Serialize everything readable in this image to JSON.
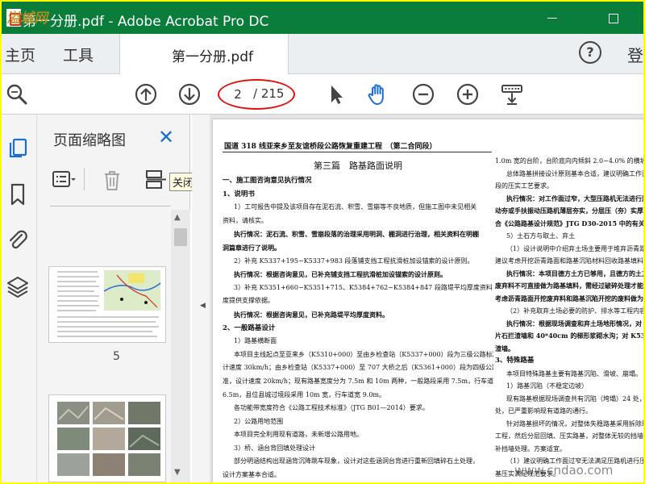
{
  "window": {
    "title": "第一分册.pdf - Adobe Acrobat Pro DC",
    "brand_color": "#0a7d3a",
    "accent_color": "#1b6fd3",
    "highlight_color": "#e01010"
  },
  "tabs": {
    "home": "主页",
    "tools": "工具",
    "document": "第一分册.pdf",
    "help": "?",
    "signin": "登"
  },
  "toolbar": {
    "current_page": "2",
    "total_pages": "/ 215",
    "icons": [
      "search-icon",
      "page-up-icon",
      "page-down-icon",
      "select-cursor-icon",
      "hand-icon",
      "zoom-out-icon",
      "zoom-in-icon",
      "keyboard-icon"
    ]
  },
  "rail": {
    "icons": [
      "copy-pages-icon",
      "bookmark-icon",
      "attachment-icon",
      "layers-icon"
    ]
  },
  "thumbnails": {
    "title": "页面缩略图",
    "tooltip": "关闭",
    "page_label": "5"
  },
  "watermark": {
    "top_left": "溢城网",
    "bottom_right": "www.cndao.com"
  },
  "document": {
    "header": "国道 318 线亚来乡至友谊桥段公路恢复重建工程　（第二合同段）",
    "left_lines": [
      {
        "t": "第三篇　路基路面说明",
        "c": "center"
      },
      {
        "t": "一、施工图咨询意见执行情况",
        "c": "sec"
      },
      {
        "t": "1、说明书",
        "c": "sec"
      },
      {
        "t": "1）工可报告中提及该项目存在泥石流、积雪、雪崩等不良地质，但施工图中未见相关",
        "c": "ind"
      },
      {
        "t": "资料，请核实。",
        "c": ""
      },
      {
        "t": "执行情况：泥石流、积雪、雪崩段落的治理采用明洞、棚洞进行治理，相关资料在明棚",
        "c": "ind b"
      },
      {
        "t": "洞篇章进行了说明。",
        "c": "b"
      },
      {
        "t": "2）补充 K5337+195~K5337+983 段落铺支挡工程抗滑桩加设锚索的设计原则。",
        "c": "ind"
      },
      {
        "t": "执行情况：根据咨询意见，已补充铺支挡工程抗滑桩加设锚索的设计原则。",
        "c": "ind b"
      },
      {
        "t": "3）补充 K5351+660~K5351+715、K5384+762~K5384+847 段路堤平均厚度资料，为确轩长",
        "c": "ind"
      },
      {
        "t": "度提供支撑依据。",
        "c": ""
      },
      {
        "t": "执行情况：根据咨询意见，已补充路堤平均厚度资料。",
        "c": "ind b"
      },
      {
        "t": "2、一般路基设计",
        "c": "sec"
      },
      {
        "t": "1）路基横断面",
        "c": "ind"
      },
      {
        "t": "本项目主线起点至亚来乡（K5310+000）至由乡检查站（K5337+000）段为三级公路标准，设",
        "c": "ind"
      },
      {
        "t": "计速度 30km/h；由乡检查站（K5337+000）至 707 大桥之后（K5361+000）段为四级公路标",
        "c": ""
      },
      {
        "t": "准，设计速度 20km/h；现有路基宽度分为 7.5m 和 10m 两种，一般路段采用 7.5m，行车道宽",
        "c": ""
      },
      {
        "t": "6.5m，县位县城过境段采用 10m 宽，行车道宽 9.0m。",
        "c": ""
      },
      {
        "t": "各功能带宽度符合《公路工程技术标准》（JTG B01—2014）要求。",
        "c": "ind"
      },
      {
        "t": "2）公路用地范围",
        "c": "ind"
      },
      {
        "t": "本项目完全利用现有道路，未新增公路用地。",
        "c": "ind"
      },
      {
        "t": "3）桥、涵台背回填处理设计",
        "c": "ind"
      },
      {
        "t": "部分明涵结构出现涵背沉降跳车现象，设计对这些涵洞台背进行重新回填碎石土处理，",
        "c": "ind"
      },
      {
        "t": "设计方案基本合适。",
        "c": ""
      },
      {
        "t": "4）路基拼接设计",
        "c": "ind"
      }
    ],
    "right_lines": [
      {
        "t": "1.0m 宽的台阶，台阶底向内倾斜 2.0~4.0% 的横坡。",
        "c": ""
      },
      {
        "t": "总体路基拼接设计原则基本合适，建议明确工作面过",
        "c": "ind"
      },
      {
        "t": "段的压实工艺要求。",
        "c": ""
      },
      {
        "t": "执行情况：对工作面过窄，大型压路机无法进行压实",
        "c": "ind b"
      },
      {
        "t": "动夯或手扶振动压路机薄层夯实，分层压（夯）实厚度不",
        "c": "b"
      },
      {
        "t": "合《公路路基设计规范》JTG D30-2015 中的有关规定。",
        "c": "b"
      },
      {
        "t": "5）土石方与取土、弃土",
        "c": "ind"
      },
      {
        "t": "（1）设计说明中介绍弃土场主要用于堆弃沥青路面",
        "c": "ind"
      },
      {
        "t": "建议考虑开挖沥青路面和路基沉陷材料回收路基填料使",
        "c": ""
      },
      {
        "t": "执行情况：本项目德方土方已够用，且德方的土方宁",
        "c": "ind b"
      },
      {
        "t": "废弃料不可直接做为路基填料，需经过破碎处理才能做为",
        "c": "b"
      },
      {
        "t": "考虑沥青路面开挖废弃料和路基沉陷开挖的废料做为路基",
        "c": "b"
      },
      {
        "t": "（2）补充取弃土场必要的防护、排水等工程内容。",
        "c": "ind"
      },
      {
        "t": "执行情况：根据现场调查和弃土场地形情况，对 K53",
        "c": "ind b"
      },
      {
        "t": "片石拦渣墙和 40*40cm 的梯形浆砌水沟；对 K5370+250",
        "c": "b"
      },
      {
        "t": "渣墙。",
        "c": "b"
      },
      {
        "t": "3、特殊路基",
        "c": "sec"
      },
      {
        "t": "本项目特殊路基主要有路基沉陷、滑坡、崩塌。",
        "c": "ind"
      },
      {
        "t": "1）路基沉陷（不稳定边坡）",
        "c": "ind"
      },
      {
        "t": "现有路基根据现场调查共有沉陷（垮塌）24 处，影",
        "c": "ind"
      },
      {
        "t": "处，已严重影响现有道路的通行。",
        "c": ""
      },
      {
        "t": "针对路基损坏的情况，对整体失稳路基采用拆除现有",
        "c": "ind"
      },
      {
        "t": "工程，然后分层回填、压实路基，对整体无较的挡墙和路",
        "c": ""
      },
      {
        "t": "补挡墙处理。方案适宜。",
        "c": ""
      },
      {
        "t": "（1）建议明确工作面过窄无法满足压路机进行压实",
        "c": "ind"
      },
      {
        "t": "基压实满足规范要求。",
        "c": ""
      },
      {
        "t": "执行情况：对于工作面过窄大型压路机无法进行压",
        "c": "ind b"
      }
    ]
  }
}
